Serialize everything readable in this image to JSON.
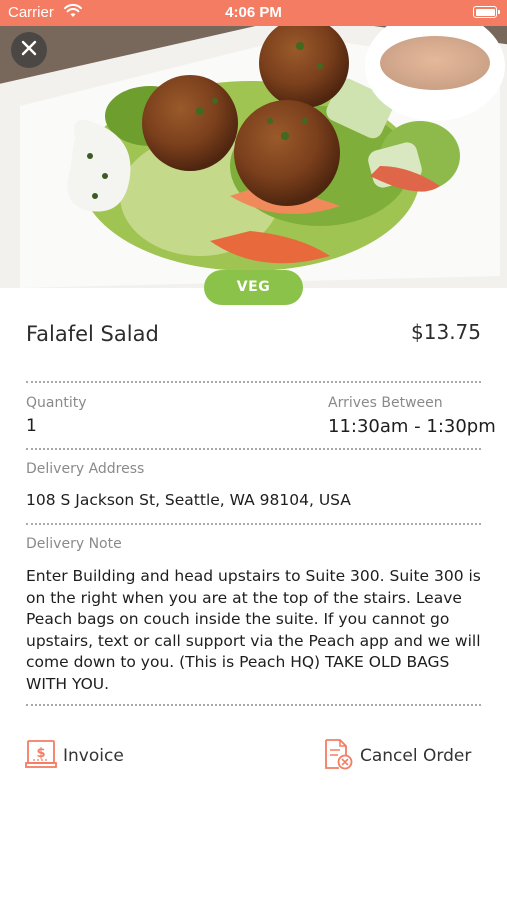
{
  "status_bar": {
    "carrier": "Carrier",
    "time": "4:06 PM"
  },
  "hero": {
    "badge": "VEG"
  },
  "item": {
    "name": "Falafel Salad",
    "price": "$13.75"
  },
  "details": {
    "quantity_label": "Quantity",
    "quantity_value": "1",
    "arrives_label": "Arrives Between",
    "arrives_value": "11:30am - 1:30pm",
    "address_label": "Delivery Address",
    "address_value": "108 S Jackson St, Seattle, WA 98104, USA",
    "note_label": "Delivery Note",
    "note_value": "Enter Building and head upstairs to Suite 300. Suite 300 is on the right when you are at the top of the stairs. Leave Peach bags on couch inside the suite. If you cannot go upstairs, text or call support via the Peach app and we will come down to you. (This is Peach HQ) TAKE OLD BAGS WITH YOU."
  },
  "actions": {
    "invoice_label": "Invoice",
    "cancel_label": "Cancel Order"
  },
  "icons": {
    "invoice": "invoice-icon",
    "cancel": "cancel-order-icon",
    "close": "close-icon"
  },
  "colors": {
    "status_bar": "#f47c62",
    "badge": "#8bc34a",
    "icon_accent": "#f47c62"
  }
}
